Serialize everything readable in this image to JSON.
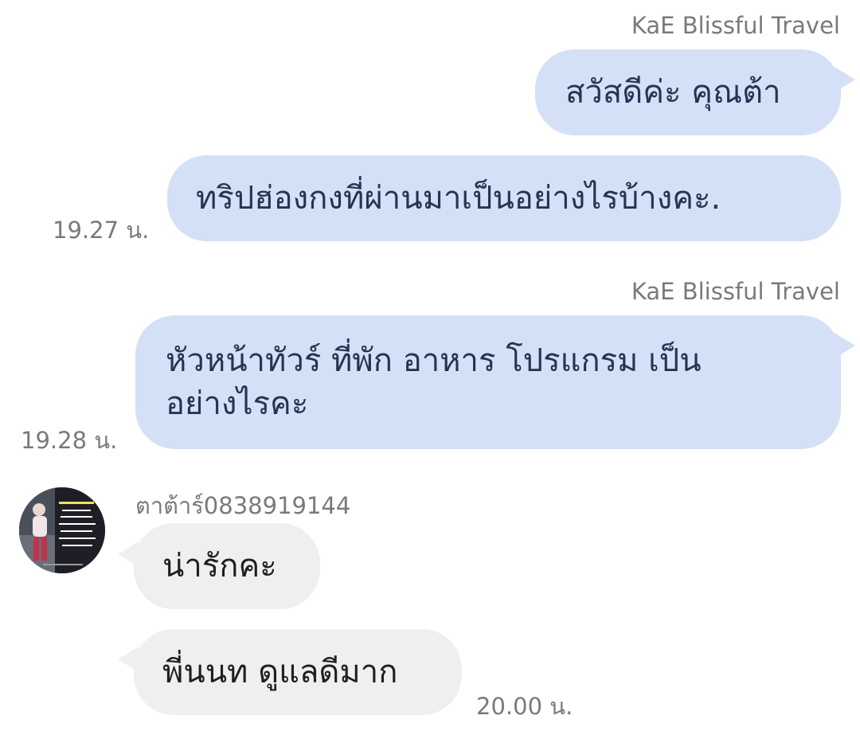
{
  "messages": [
    {
      "sender": "KaE Blissful Travel",
      "text": "สวัสดีค่ะ คุณต้า"
    },
    {
      "text": "ทริปฮ่องกงที่ผ่านมาเป็นอย่างไรบ้างคะ.",
      "time": "19.27 น."
    },
    {
      "sender": "KaE Blissful Travel",
      "line1": "หัวหน้าทัวร์ ที่พัก อาหาร โปรแกรม เป็น",
      "line2": "อย่างไรคะ",
      "time": "19.28 น."
    },
    {
      "sender": "ตาต้าร์0838919144",
      "text": "น่ารักคะ"
    },
    {
      "text": "พี่นนท ดูแลดีมาก",
      "time": "20.00 น."
    }
  ],
  "colors": {
    "outgoing_bubble": "#d4e0f6",
    "incoming_bubble": "#efeff1",
    "outgoing_text": "#263352",
    "meta_text": "#7a7a7a"
  }
}
